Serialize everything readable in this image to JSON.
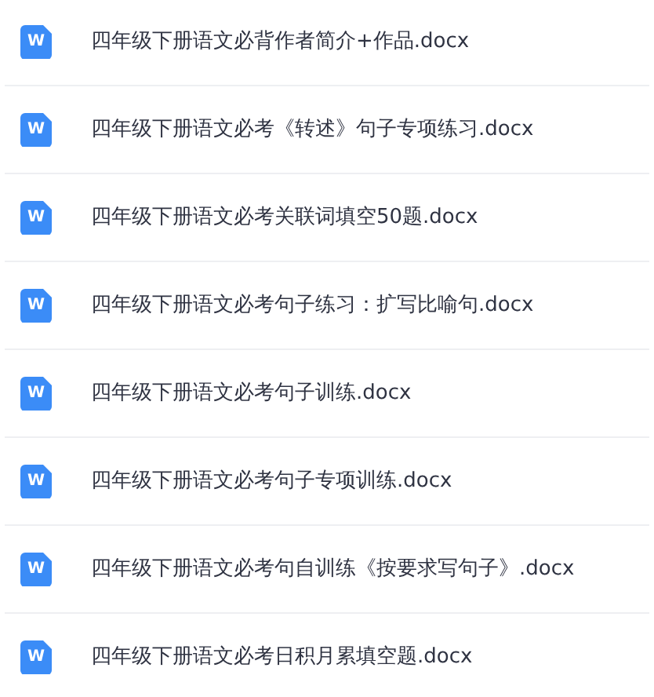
{
  "files": [
    {
      "icon_label": "W",
      "name": "四年级下册语文必背作者简介+作品.docx"
    },
    {
      "icon_label": "W",
      "name": "四年级下册语文必考《转述》句子专项练习.docx"
    },
    {
      "icon_label": "W",
      "name": "四年级下册语文必考关联词填空50题.docx"
    },
    {
      "icon_label": "W",
      "name": "四年级下册语文必考句子练习：扩写比喻句.docx"
    },
    {
      "icon_label": "W",
      "name": "四年级下册语文必考句子训练.docx"
    },
    {
      "icon_label": "W",
      "name": "四年级下册语文必考句子专项训练.docx"
    },
    {
      "icon_label": "W",
      "name": "四年级下册语文必考句自训练《按要求写句子》.docx"
    },
    {
      "icon_label": "W",
      "name": "四年级下册语文必考日积月累填空题.docx"
    }
  ]
}
